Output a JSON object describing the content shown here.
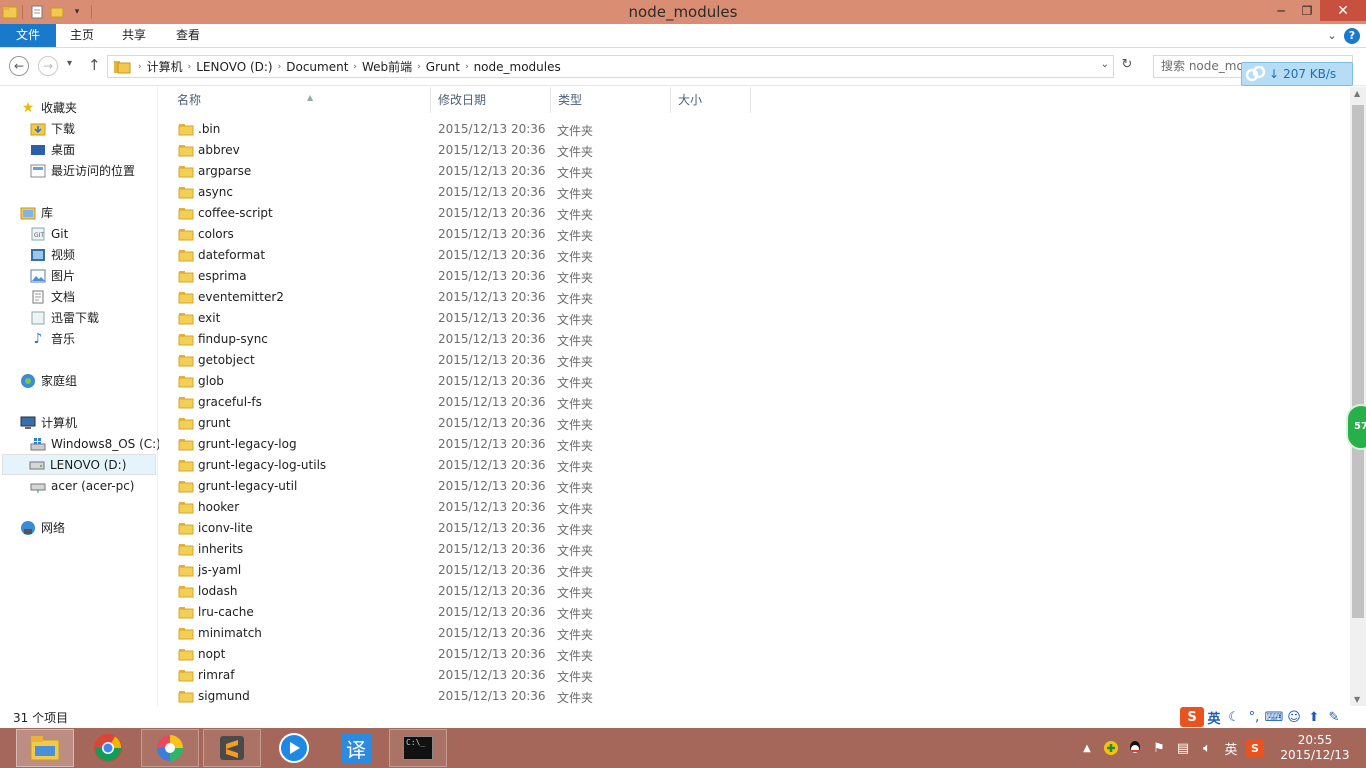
{
  "window": {
    "title": "node_modules"
  },
  "ribbon": {
    "tabs": [
      "文件",
      "主页",
      "共享",
      "查看"
    ]
  },
  "address": {
    "crumbs": [
      "计算机",
      "LENOVO (D:)",
      "Document",
      "Web前端",
      "Grunt",
      "node_modules"
    ],
    "search_placeholder": "搜索 node_modules",
    "search_visible": "搜索 node_mo"
  },
  "speed_widget": {
    "text": "207 KB/s"
  },
  "nav": {
    "favorites": {
      "label": "收藏夹",
      "items": [
        "下载",
        "桌面",
        "最近访问的位置"
      ]
    },
    "libraries": {
      "label": "库",
      "items": [
        "Git",
        "视频",
        "图片",
        "文档",
        "迅雷下载",
        "音乐"
      ]
    },
    "homegroup": "家庭组",
    "computer": {
      "label": "计算机",
      "items": [
        "Windows8_OS (C:)",
        "LENOVO (D:)",
        "acer (acer-pc)"
      ]
    },
    "network": "网络"
  },
  "columns": {
    "name": "名称",
    "modified": "修改日期",
    "type": "类型",
    "size": "大小"
  },
  "files": [
    {
      "name": ".bin",
      "date": "2015/12/13 20:36",
      "type": "文件夹"
    },
    {
      "name": "abbrev",
      "date": "2015/12/13 20:36",
      "type": "文件夹"
    },
    {
      "name": "argparse",
      "date": "2015/12/13 20:36",
      "type": "文件夹"
    },
    {
      "name": "async",
      "date": "2015/12/13 20:36",
      "type": "文件夹"
    },
    {
      "name": "coffee-script",
      "date": "2015/12/13 20:36",
      "type": "文件夹"
    },
    {
      "name": "colors",
      "date": "2015/12/13 20:36",
      "type": "文件夹"
    },
    {
      "name": "dateformat",
      "date": "2015/12/13 20:36",
      "type": "文件夹"
    },
    {
      "name": "esprima",
      "date": "2015/12/13 20:36",
      "type": "文件夹"
    },
    {
      "name": "eventemitter2",
      "date": "2015/12/13 20:36",
      "type": "文件夹"
    },
    {
      "name": "exit",
      "date": "2015/12/13 20:36",
      "type": "文件夹"
    },
    {
      "name": "findup-sync",
      "date": "2015/12/13 20:36",
      "type": "文件夹"
    },
    {
      "name": "getobject",
      "date": "2015/12/13 20:36",
      "type": "文件夹"
    },
    {
      "name": "glob",
      "date": "2015/12/13 20:36",
      "type": "文件夹"
    },
    {
      "name": "graceful-fs",
      "date": "2015/12/13 20:36",
      "type": "文件夹"
    },
    {
      "name": "grunt",
      "date": "2015/12/13 20:36",
      "type": "文件夹"
    },
    {
      "name": "grunt-legacy-log",
      "date": "2015/12/13 20:36",
      "type": "文件夹"
    },
    {
      "name": "grunt-legacy-log-utils",
      "date": "2015/12/13 20:36",
      "type": "文件夹"
    },
    {
      "name": "grunt-legacy-util",
      "date": "2015/12/13 20:36",
      "type": "文件夹"
    },
    {
      "name": "hooker",
      "date": "2015/12/13 20:36",
      "type": "文件夹"
    },
    {
      "name": "iconv-lite",
      "date": "2015/12/13 20:36",
      "type": "文件夹"
    },
    {
      "name": "inherits",
      "date": "2015/12/13 20:36",
      "type": "文件夹"
    },
    {
      "name": "js-yaml",
      "date": "2015/12/13 20:36",
      "type": "文件夹"
    },
    {
      "name": "lodash",
      "date": "2015/12/13 20:36",
      "type": "文件夹"
    },
    {
      "name": "lru-cache",
      "date": "2015/12/13 20:36",
      "type": "文件夹"
    },
    {
      "name": "minimatch",
      "date": "2015/12/13 20:36",
      "type": "文件夹"
    },
    {
      "name": "nopt",
      "date": "2015/12/13 20:36",
      "type": "文件夹"
    },
    {
      "name": "rimraf",
      "date": "2015/12/13 20:36",
      "type": "文件夹"
    },
    {
      "name": "sigmund",
      "date": "2015/12/13 20:36",
      "type": "文件夹"
    }
  ],
  "status": {
    "count": "31 个项目"
  },
  "floating_badge": "57",
  "ime": {
    "mode": "英"
  },
  "tray": {
    "lang": "英",
    "time": "20:55",
    "date": "2015/12/13"
  },
  "taskbar": {
    "apps": [
      "file-explorer-icon",
      "chrome-icon",
      "color-app-icon",
      "sublime-text-icon",
      "player-icon",
      "translate-icon",
      "cmd-icon"
    ],
    "translate_glyph": "译",
    "cmd_glyph": "C:\\_"
  },
  "colors": {
    "titlebar": "#d98d73",
    "taskbar": "#a4675a",
    "file_tab": "#1979ca",
    "close": "#c7503f"
  }
}
